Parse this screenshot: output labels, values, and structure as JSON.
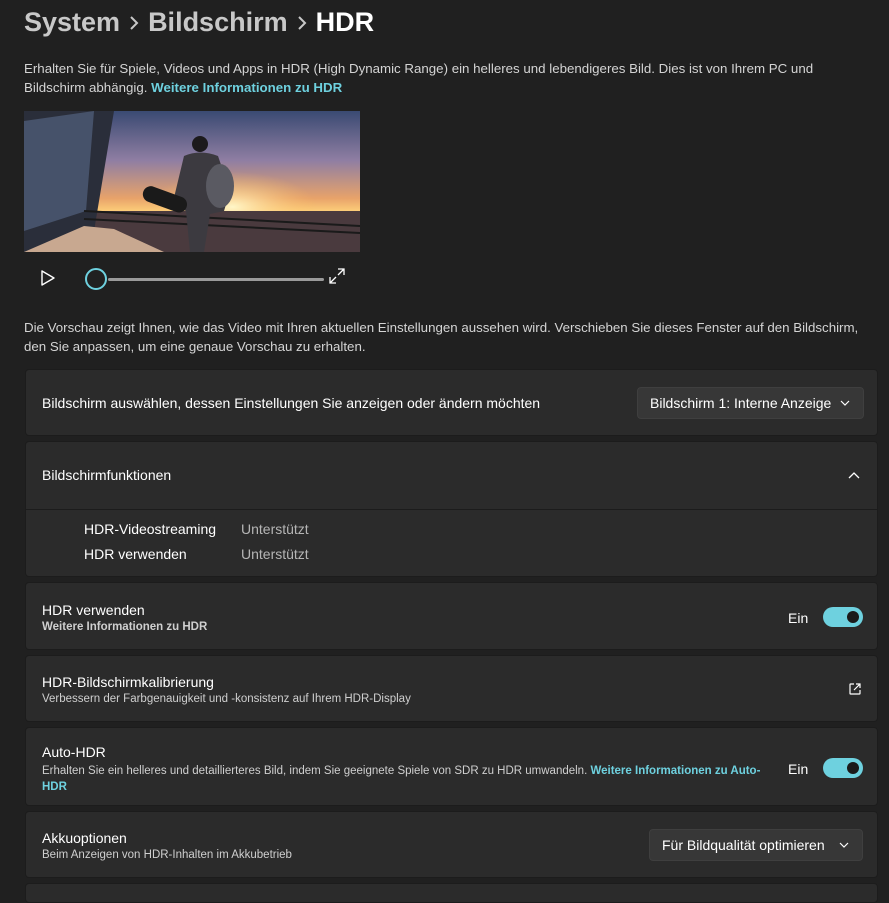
{
  "breadcrumb": {
    "items": [
      "System",
      "Bildschirm",
      "HDR"
    ]
  },
  "intro": {
    "text": "Erhalten Sie für Spiele, Videos und Apps in HDR (High Dynamic Range) ein helleres und lebendigeres Bild. Dies ist von Ihrem PC und Bildschirm abhängig. ",
    "link": "Weitere Informationen zu HDR"
  },
  "video": {
    "progress": 0
  },
  "preview_note": "Die Vorschau zeigt Ihnen, wie das Video mit Ihren aktuellen Einstellungen aussehen wird. Verschieben Sie dieses Fenster auf den Bildschirm, den Sie anpassen, um eine genaue Vorschau zu erhalten.",
  "display_select": {
    "label": "Bildschirm auswählen, dessen Einstellungen Sie anzeigen oder ändern möchten",
    "value": "Bildschirm 1: Interne Anzeige"
  },
  "capabilities": {
    "title": "Bildschirmfunktionen",
    "rows": [
      {
        "label": "HDR-Videostreaming",
        "value": "Unterstützt"
      },
      {
        "label": "HDR verwenden",
        "value": "Unterstützt"
      }
    ]
  },
  "use_hdr": {
    "title": "HDR verwenden",
    "link": "Weitere Informationen zu HDR",
    "state": "Ein"
  },
  "calibration": {
    "title": "HDR-Bildschirmkalibrierung",
    "sub": "Verbessern der Farbgenauigkeit und -konsistenz auf Ihrem HDR-Display"
  },
  "auto_hdr": {
    "title": "Auto-HDR",
    "sub": "Erhalten Sie ein helleres und detaillierteres Bild, indem Sie geeignete Spiele von SDR zu HDR umwandeln. ",
    "link": "Weitere Informationen zu Auto-HDR",
    "state": "Ein"
  },
  "battery": {
    "title": "Akkuoptionen",
    "sub": "Beim Anzeigen von HDR-Inhalten im Akkubetrieb",
    "value": "Für Bildqualität optimieren"
  },
  "colors": {
    "accent": "#6ed1df",
    "background": "#202020",
    "card": "#2b2b2b"
  }
}
